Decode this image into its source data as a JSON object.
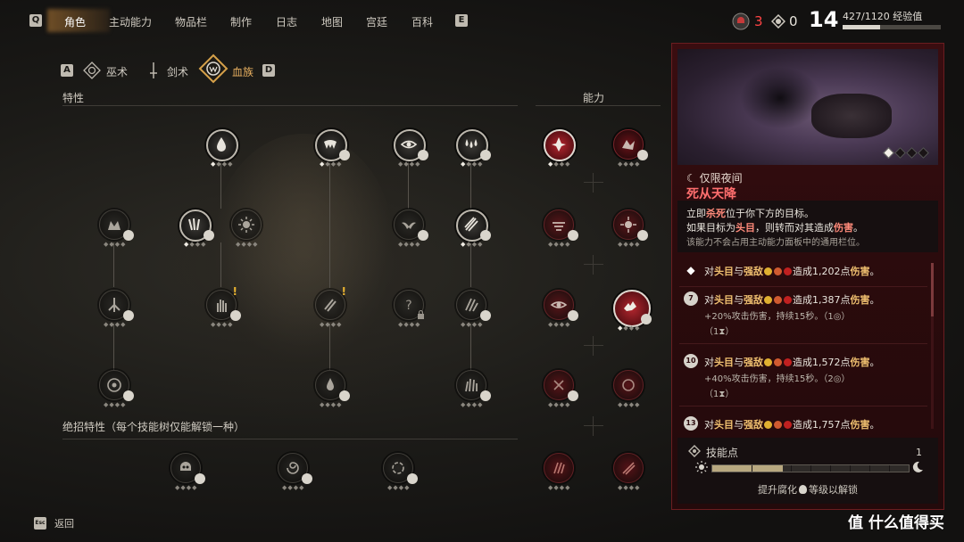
{
  "nav": {
    "key_left": "Q",
    "key_right": "E",
    "tabs": [
      "角色",
      "主动能力",
      "物品栏",
      "制作",
      "日志",
      "地图",
      "宫廷",
      "百科"
    ],
    "active_tab": "角色"
  },
  "stats": {
    "skull_count": "3",
    "mana_count": "0",
    "level": "14",
    "exp_text": "427/1120 经验值",
    "exp_fraction": 0.381
  },
  "tree_tabs": {
    "key_left": "A",
    "key_right": "D",
    "items": [
      "巫术",
      "剑术",
      "血族"
    ],
    "active": "血族"
  },
  "sections": {
    "traits": "特性",
    "abilities": "能力",
    "ultimate": "绝招特性（每个技能树仅能解锁一种）"
  },
  "panel": {
    "tags": "☾ 仅限夜间",
    "title": "死从天降",
    "desc": {
      "l1a": "立即",
      "l1b": "杀死",
      "l1c": "位于你下方的目标。",
      "l2a": "如果目标为",
      "l2b": "头目",
      "l2c": "，则转而对其造成",
      "l2d": "伤害",
      "l2e": "。",
      "l3": "该能力不会占用主动能力面板中的通用栏位。"
    },
    "ranks": [
      {
        "icon": "◆",
        "pre": "对",
        "t1": "头目",
        "mid": "与",
        "t2": "强敌",
        "post": "造成",
        "dmg": "1,202",
        "unit": "点",
        "t3": "伤害",
        "end": "。",
        "sub1": "",
        "sub2": ""
      },
      {
        "icon": "7",
        "pre": "对",
        "t1": "头目",
        "mid": "与",
        "t2": "强敌",
        "post": "造成",
        "dmg": "1,387",
        "unit": "点",
        "t3": "伤害",
        "end": "。",
        "sub1": "+20%攻击伤害，持续15秒。（1◎）",
        "sub2": "（1⧗）"
      },
      {
        "icon": "10",
        "pre": "对",
        "t1": "头目",
        "mid": "与",
        "t2": "强敌",
        "post": "造成",
        "dmg": "1,572",
        "unit": "点",
        "t3": "伤害",
        "end": "。",
        "sub1": "+40%攻击伤害，持续15秒。（2◎）",
        "sub2": "（1⧗）"
      },
      {
        "icon": "13",
        "pre": "对",
        "t1": "头目",
        "mid": "与",
        "t2": "强敌",
        "post": "造成",
        "dmg": "1,757",
        "unit": "点",
        "t3": "伤害",
        "end": "。",
        "sub1": "",
        "sub2": ""
      }
    ],
    "skill_points_label": "技能点",
    "skill_points_value": "1",
    "corruption_fraction": 0.36,
    "unlock_hint": "提升腐化",
    "unlock_hint2": "等级以解锁"
  },
  "footer": {
    "key": "Esc",
    "back": "返回"
  },
  "watermark": "值 什么值得买",
  "colors": {
    "panel_bg": "#2c0b0d",
    "accent_red": "#ff6e6e",
    "gold": "#e8b230"
  }
}
